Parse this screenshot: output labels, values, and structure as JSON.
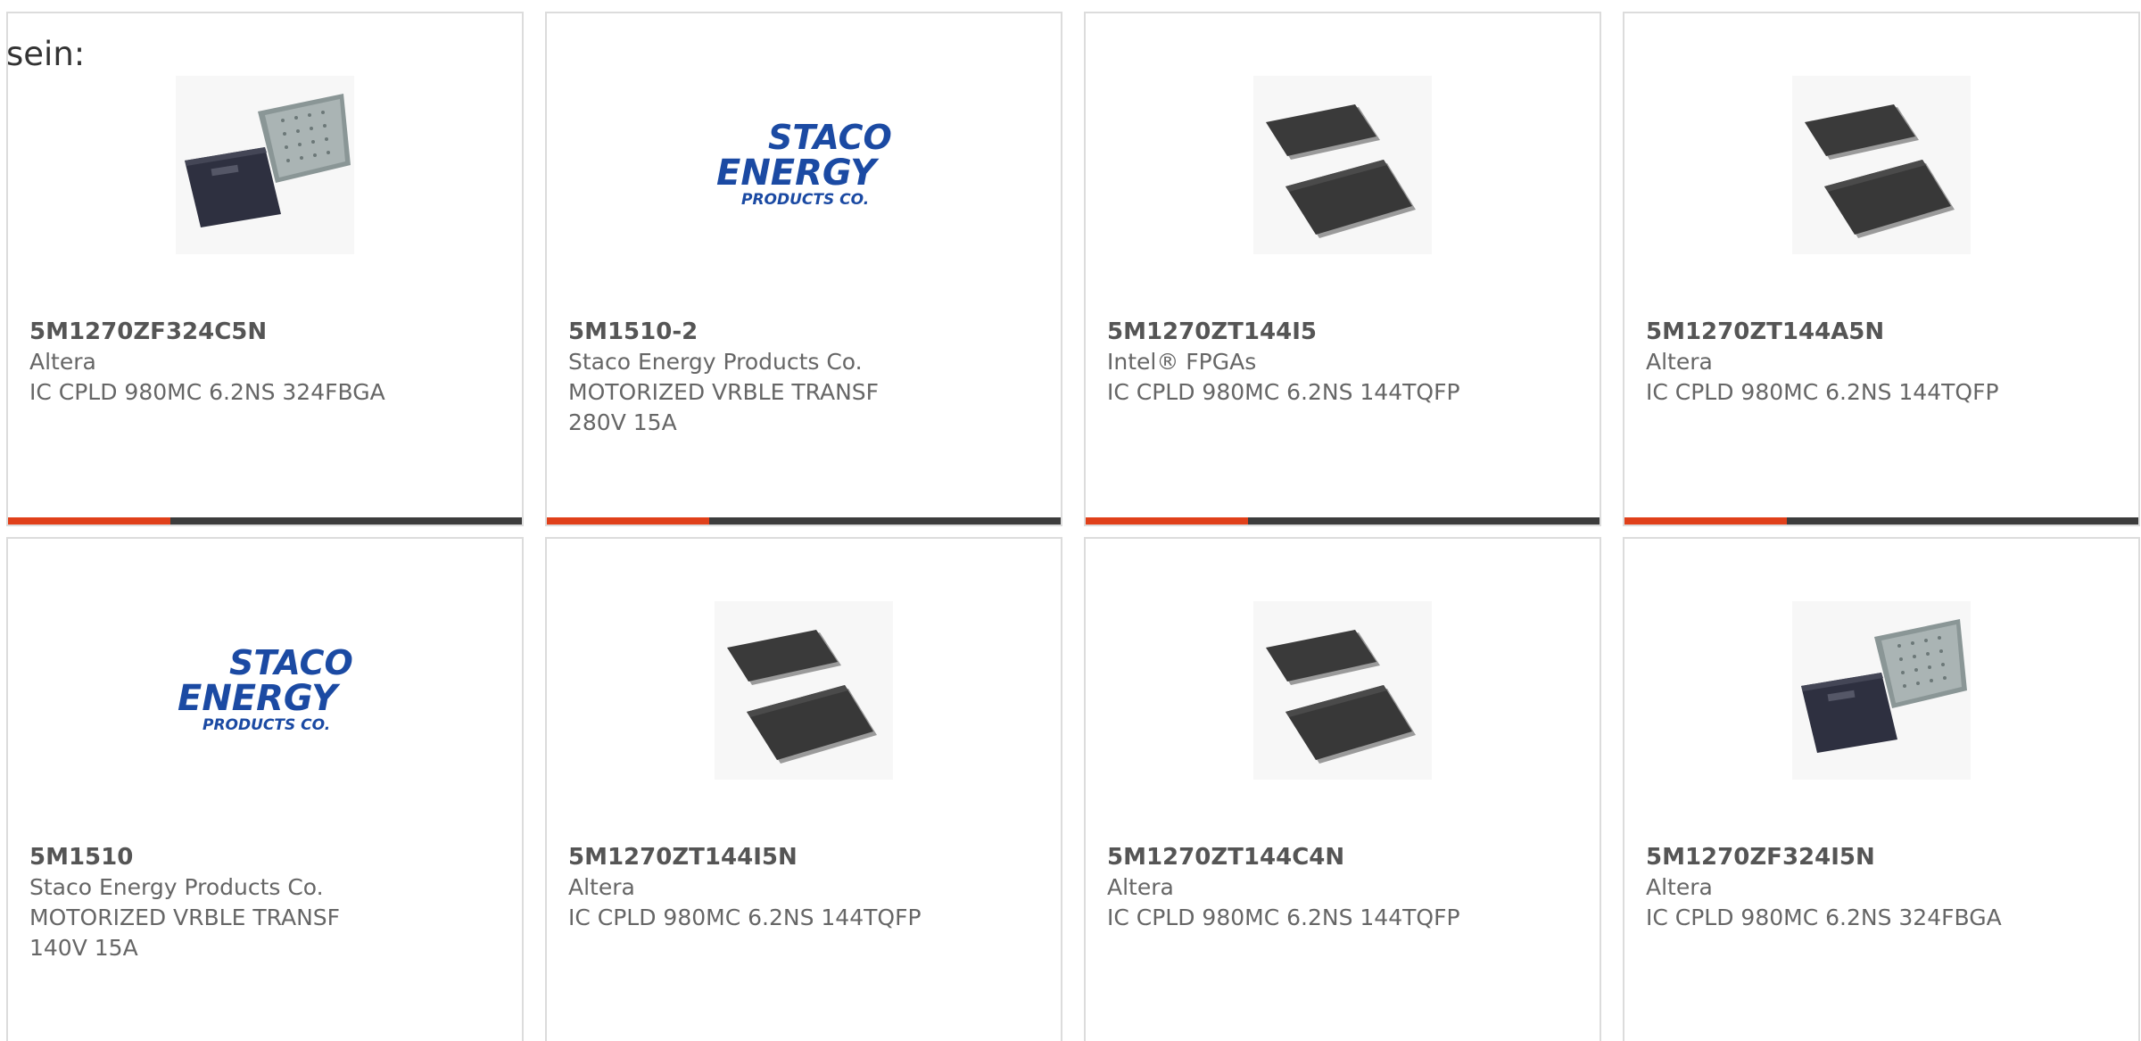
{
  "intro_text": "sein:",
  "colors": {
    "accent": "#e0401a",
    "bar": "#3c3c3c",
    "logo_blue": "#1b4aa3"
  },
  "logo_text": {
    "line1": "STACO",
    "line2": "ENERGY",
    "line3": "PRODUCTS CO."
  },
  "products": [
    {
      "part_number": "5M1270ZF324C5N",
      "manufacturer": "Altera",
      "description": "IC CPLD 980MC 6.2NS 324FBGA",
      "image": "bga-chip-image"
    },
    {
      "part_number": "5M1510-2",
      "manufacturer": "Staco Energy Products Co.",
      "description": "MOTORIZED VRBLE TRANSF\n280V 15A",
      "image": "staco-logo"
    },
    {
      "part_number": "5M1270ZT144I5",
      "manufacturer": "Intel® FPGAs",
      "description": "IC CPLD 980MC 6.2NS 144TQFP",
      "image": "tqfp-chip-image"
    },
    {
      "part_number": "5M1270ZT144A5N",
      "manufacturer": "Altera",
      "description": "IC CPLD 980MC 6.2NS 144TQFP",
      "image": "tqfp-chip-image"
    },
    {
      "part_number": "5M1510",
      "manufacturer": "Staco Energy Products Co.",
      "description": "MOTORIZED VRBLE TRANSF\n140V 15A",
      "image": "staco-logo"
    },
    {
      "part_number": "5M1270ZT144I5N",
      "manufacturer": "Altera",
      "description": "IC CPLD 980MC 6.2NS 144TQFP",
      "image": "tqfp-chip-image"
    },
    {
      "part_number": "5M1270ZT144C4N",
      "manufacturer": "Altera",
      "description": "IC CPLD 980MC 6.2NS 144TQFP",
      "image": "tqfp-chip-image"
    },
    {
      "part_number": "5M1270ZF324I5N",
      "manufacturer": "Altera",
      "description": "IC CPLD 980MC 6.2NS 324FBGA",
      "image": "bga-chip-image"
    }
  ]
}
